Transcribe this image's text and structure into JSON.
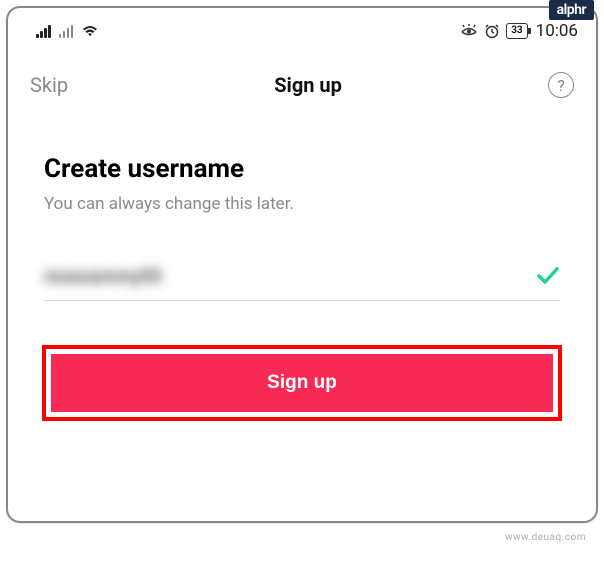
{
  "badge": "alphr",
  "watermark": "www.deuaq.com",
  "status": {
    "battery": "33",
    "time": "10:06"
  },
  "nav": {
    "skip": "Skip",
    "title": "Sign up",
    "help": "?"
  },
  "main": {
    "heading": "Create username",
    "subtext": "You can always change this later.",
    "username_blur": "rosesammy00"
  },
  "button": {
    "signup": "Sign up"
  }
}
